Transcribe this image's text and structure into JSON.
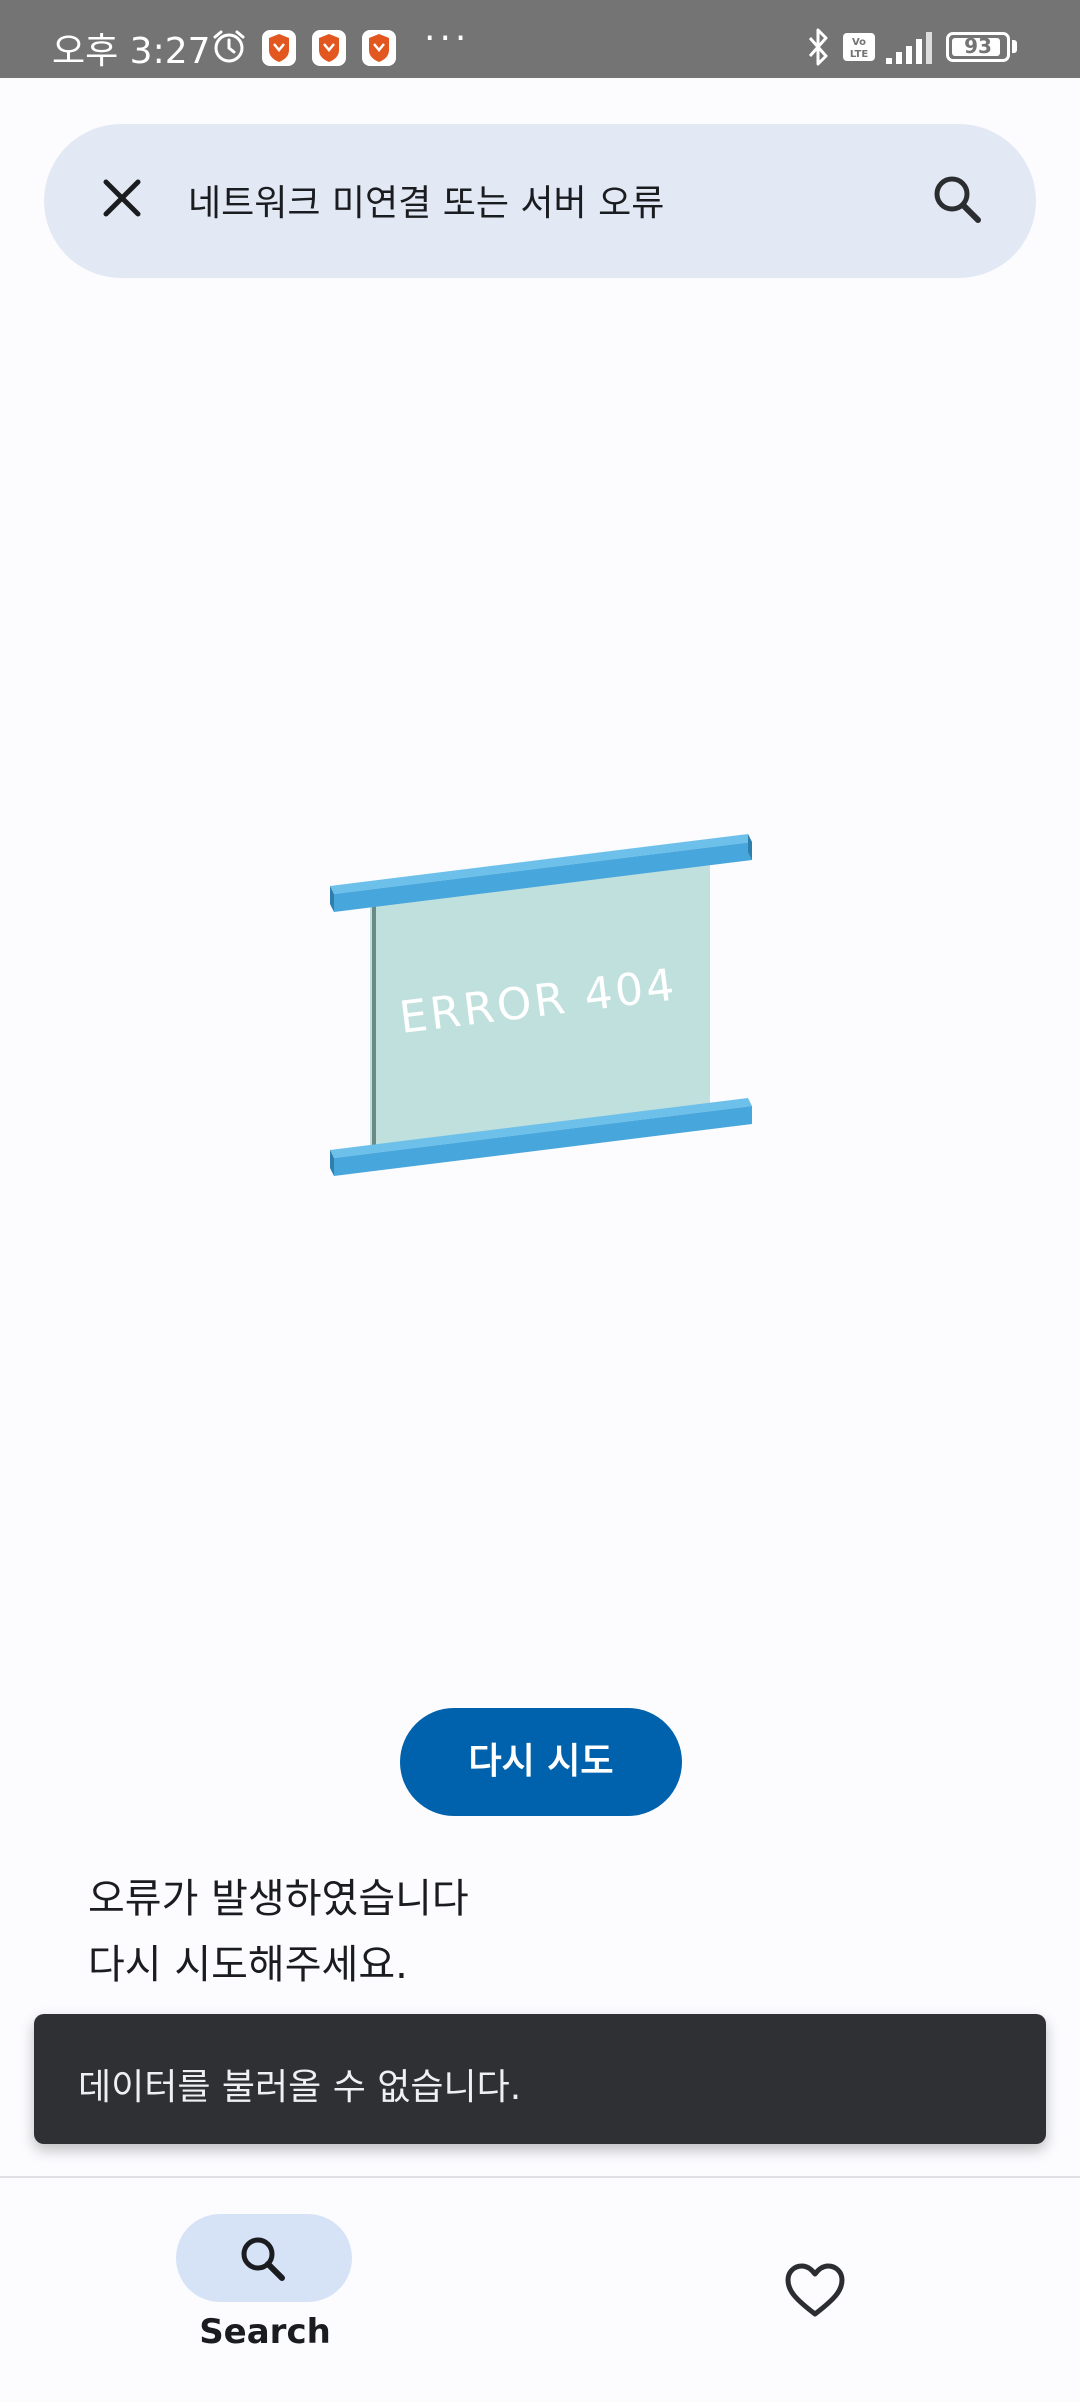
{
  "status_bar": {
    "time": "오후 3:27",
    "more_indicator": "···",
    "battery_level": "93",
    "icons": [
      "alarm-icon",
      "brave-icon",
      "brave-icon",
      "brave-icon",
      "bluetooth-icon",
      "volte-icon",
      "signal-icon",
      "battery-icon"
    ]
  },
  "search": {
    "query": "네트워크 미연결 또는 서버 오류",
    "close_icon": "close-icon",
    "search_icon": "search-icon"
  },
  "illustration": {
    "text": "ERROR 404",
    "colors": {
      "rail": "#47a6dc",
      "panel": "#bfe0dd"
    }
  },
  "main": {
    "retry_label": "다시 시도",
    "error_line1": "오류가 발생하였습니다",
    "error_line2": "다시 시도해주세요."
  },
  "snackbar": {
    "message": "데이터를 불러올 수 없습니다."
  },
  "bottom_nav": {
    "items": [
      {
        "label": "Search",
        "icon": "search-icon",
        "selected": true
      },
      {
        "label": "",
        "icon": "heart-icon",
        "selected": false
      }
    ]
  },
  "colors": {
    "accent": "#0062ad",
    "search_bar_bg": "#e2e9f4",
    "nav_pill": "#d6e3f7",
    "snackbar_bg": "#2e3034"
  }
}
